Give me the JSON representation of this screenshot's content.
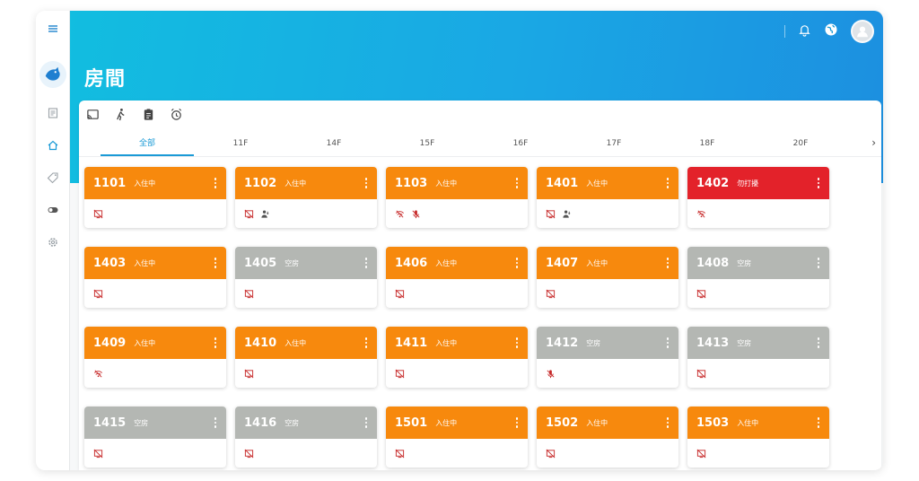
{
  "header": {
    "title": "房間",
    "icons": [
      "notification-bell-icon",
      "globe-icon",
      "user-avatar-icon"
    ]
  },
  "sidebar": {
    "items": [
      "menu-icon",
      "logo",
      "document-icon",
      "home-icon",
      "tag-icon",
      "toggle-icon",
      "settings-icon"
    ]
  },
  "toolbar": {
    "icons": [
      "cast-icon",
      "walk-icon",
      "clipboard-icon",
      "alarm-icon"
    ]
  },
  "tabs": [
    {
      "label": "全部",
      "active": true
    },
    {
      "label": "11F",
      "active": false
    },
    {
      "label": "14F",
      "active": false
    },
    {
      "label": "15F",
      "active": false
    },
    {
      "label": "16F",
      "active": false
    },
    {
      "label": "17F",
      "active": false
    },
    {
      "label": "18F",
      "active": false
    },
    {
      "label": "20F",
      "active": false
    }
  ],
  "tabs_next": "›",
  "colors": {
    "occupied": "#f7890d",
    "vacant": "#b4b7b3",
    "do_not_disturb": "#e3222a",
    "accent": "#1a9ad6"
  },
  "rooms": [
    {
      "number": "1101",
      "status": "入住中",
      "state": "occ",
      "icons": [
        "screen-off"
      ]
    },
    {
      "number": "1102",
      "status": "入住中",
      "state": "occ",
      "icons": [
        "screen-off",
        "person-in"
      ]
    },
    {
      "number": "1103",
      "status": "入住中",
      "state": "occ",
      "icons": [
        "wifi-off",
        "mic-off"
      ]
    },
    {
      "number": "1401",
      "status": "入住中",
      "state": "occ",
      "icons": [
        "screen-off",
        "person-in"
      ]
    },
    {
      "number": "1402",
      "status": "勿打擾",
      "state": "dnd",
      "icons": [
        "wifi-off"
      ]
    },
    {
      "number": "1403",
      "status": "入住中",
      "state": "occ",
      "icons": [
        "screen-off"
      ]
    },
    {
      "number": "1405",
      "status": "空房",
      "state": "vac",
      "icons": [
        "screen-off"
      ]
    },
    {
      "number": "1406",
      "status": "入住中",
      "state": "occ",
      "icons": [
        "screen-off"
      ]
    },
    {
      "number": "1407",
      "status": "入住中",
      "state": "occ",
      "icons": [
        "screen-off"
      ]
    },
    {
      "number": "1408",
      "status": "空房",
      "state": "vac",
      "icons": [
        "screen-off"
      ]
    },
    {
      "number": "1409",
      "status": "入住中",
      "state": "occ",
      "icons": [
        "wifi-off"
      ]
    },
    {
      "number": "1410",
      "status": "入住中",
      "state": "occ",
      "icons": [
        "screen-off"
      ]
    },
    {
      "number": "1411",
      "status": "入住中",
      "state": "occ",
      "icons": [
        "screen-off"
      ]
    },
    {
      "number": "1412",
      "status": "空房",
      "state": "vac",
      "icons": [
        "mic-off"
      ]
    },
    {
      "number": "1413",
      "status": "空房",
      "state": "vac",
      "icons": [
        "screen-off"
      ]
    },
    {
      "number": "1415",
      "status": "空房",
      "state": "vac",
      "icons": [
        "screen-off"
      ]
    },
    {
      "number": "1416",
      "status": "空房",
      "state": "vac",
      "icons": [
        "screen-off"
      ]
    },
    {
      "number": "1501",
      "status": "入住中",
      "state": "occ",
      "icons": [
        "screen-off"
      ]
    },
    {
      "number": "1502",
      "status": "入住中",
      "state": "occ",
      "icons": [
        "screen-off"
      ]
    },
    {
      "number": "1503",
      "status": "入住中",
      "state": "occ",
      "icons": [
        "screen-off"
      ]
    }
  ]
}
